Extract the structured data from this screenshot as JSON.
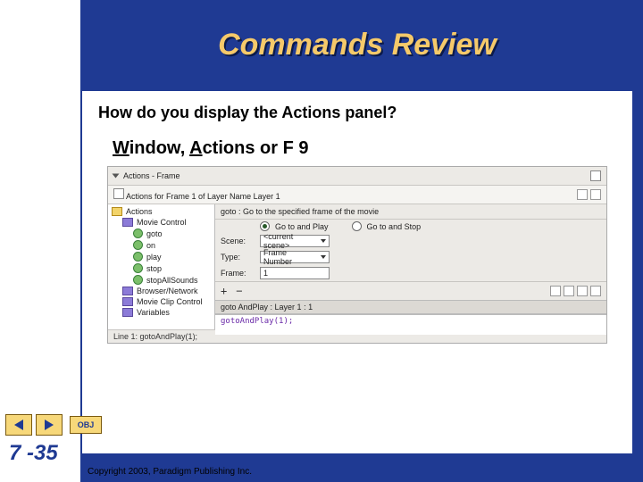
{
  "title": "Commands Review",
  "question": "How do you display the Actions panel?",
  "answer": {
    "window_u": "W",
    "window_rest": "indow, ",
    "actions_u": "A",
    "actions_rest": "ctions or F 9"
  },
  "panel": {
    "tab": "Actions - Frame",
    "sub": "Actions for Frame 1 of Layer Name Layer 1",
    "tree": {
      "root": "Actions",
      "group": "Movie Control",
      "items": [
        "goto",
        "on",
        "play",
        "stop",
        "stopAllSounds"
      ],
      "more": [
        "Browser/Network",
        "Movie Clip Control",
        "Variables"
      ]
    },
    "desc": "goto : Go to the specified frame of the movie",
    "radios": {
      "play": "Go to and Play",
      "stop": "Go to and Stop"
    },
    "form": {
      "scene_label": "Scene:",
      "scene_value": "<current scene>",
      "type_label": "Type:",
      "type_value": "Frame Number",
      "frame_label": "Frame:",
      "frame_value": "1"
    },
    "toolbar": {
      "plus": "+",
      "minus": "−"
    },
    "code_head": "goto AndPlay : Layer 1 : 1",
    "code": "gotoAndPlay(1);",
    "footer": "Line 1: gotoAndPlay(1);"
  },
  "nav": {
    "obj": "OBJ"
  },
  "page": "7 -35",
  "copyright": "Copyright 2003, Paradigm Publishing Inc."
}
